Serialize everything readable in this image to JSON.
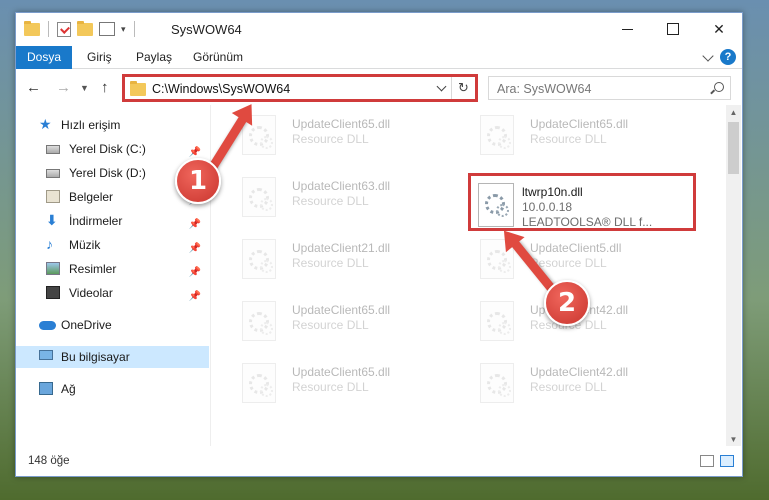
{
  "window": {
    "title": "SysWOW64",
    "controls": [
      "minimize",
      "maximize",
      "close"
    ]
  },
  "ribbon": {
    "file_tab": "Dosya",
    "tabs": [
      "Giriş",
      "Paylaş",
      "Görünüm"
    ],
    "help": "?"
  },
  "address": {
    "path": "C:\\Windows\\SysWOW64",
    "search_placeholder": "Ara: SysWOW64"
  },
  "nav": {
    "items": [
      {
        "label": "Hızlı erişim",
        "icon": "star-icon",
        "pinned": false
      },
      {
        "label": "Yerel Disk (C:)",
        "icon": "drive-icon",
        "pinned": true
      },
      {
        "label": "Yerel Disk (D:)",
        "icon": "drive-icon",
        "pinned": false
      },
      {
        "label": "Belgeler",
        "icon": "documents-icon",
        "pinned": true
      },
      {
        "label": "İndirmeler",
        "icon": "download-icon",
        "pinned": true
      },
      {
        "label": "Müzik",
        "icon": "music-icon",
        "pinned": true
      },
      {
        "label": "Resimler",
        "icon": "pictures-icon",
        "pinned": true
      },
      {
        "label": "Videolar",
        "icon": "videos-icon",
        "pinned": true
      },
      {
        "label": "OneDrive",
        "icon": "cloud-icon",
        "pinned": false
      },
      {
        "label": "Bu bilgisayar",
        "icon": "computer-icon",
        "pinned": false,
        "selected": true
      },
      {
        "label": "Ağ",
        "icon": "network-icon",
        "pinned": false
      }
    ]
  },
  "files": {
    "left": [
      {
        "name": "UpdateClient65.dll",
        "desc": "Resource DLL"
      },
      {
        "name": "UpdateClient63.dll",
        "desc": "Resource DLL"
      },
      {
        "name": "UpdateClient21.dll",
        "desc": "Resource DLL"
      },
      {
        "name": "UpdateClient65.dll",
        "desc": "Resource DLL"
      },
      {
        "name": "UpdateClient65.dll",
        "desc": "Resource DLL"
      }
    ],
    "right": [
      {
        "name": "UpdateClient65.dll",
        "desc": "Resource DLL"
      },
      {
        "name": "UpdateClient5.dll",
        "desc": "Resource DLL"
      },
      {
        "name": "UpdateClient42.dll",
        "desc": "Resource DLL"
      },
      {
        "name": "UpdateClient42.dll",
        "desc": "Resource DLL"
      }
    ],
    "highlighted": {
      "name": "ltwrp10n.dll",
      "version": "10.0.0.18",
      "desc": "LEADTOOLSA® DLL f..."
    }
  },
  "annotations": {
    "badge1": "1",
    "badge2": "2",
    "color": "#d03b3b"
  },
  "status": {
    "count": "148 öğe"
  }
}
